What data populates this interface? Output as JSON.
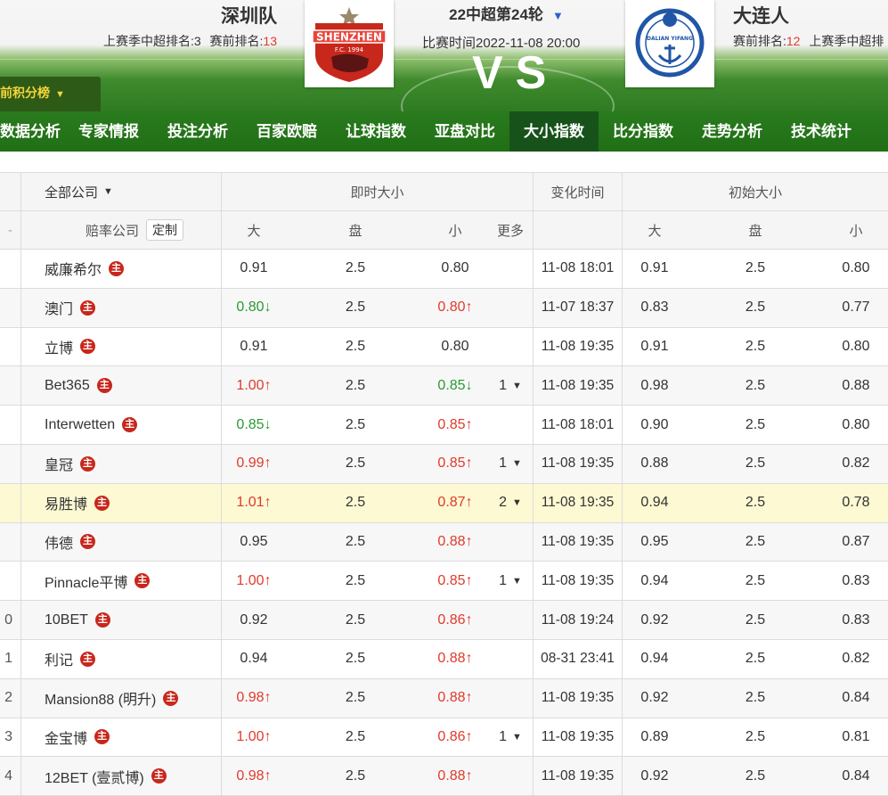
{
  "match": {
    "home": {
      "name": "深圳队",
      "rank_text": "上赛季中超排名:3",
      "pre_rank_label": "赛前排名:",
      "pre_rank_value": "13"
    },
    "away": {
      "name": "大连人",
      "pre_rank_label": "赛前排名:",
      "pre_rank_value": "12",
      "rank_text": "上赛季中超排"
    },
    "round": "22中超第24轮",
    "time": "比赛时间2022-11-08 20:00",
    "vs": "VS",
    "standings": "前积分榜"
  },
  "nav": [
    "数据分析",
    "专家情报",
    "投注分析",
    "百家欧赔",
    "让球指数",
    "亚盘对比",
    "大小指数",
    "比分指数",
    "走势分析",
    "技术统计"
  ],
  "nav_active": "大小指数",
  "table": {
    "all_companies": "全部公司",
    "live_group": "即时大小",
    "change_time": "变化时间",
    "initial_group": "初始大小",
    "company_col": "赔率公司",
    "customize": "定制",
    "col_big": "大",
    "col_line": "盘",
    "col_small": "小",
    "col_more": "更多",
    "main_badge": "主",
    "rows": [
      {
        "no": "",
        "company": "威廉希尔",
        "big": "0.91",
        "big_dir": "",
        "line": "2.5",
        "small": "0.80",
        "small_dir": "",
        "more": "",
        "time": "11-08 18:01",
        "i_big": "0.91",
        "i_line": "2.5",
        "i_small": "0.80"
      },
      {
        "no": "",
        "company": "澳门",
        "big": "0.80",
        "big_dir": "down",
        "line": "2.5",
        "small": "0.80",
        "small_dir": "up",
        "more": "",
        "time": "11-07 18:37",
        "i_big": "0.83",
        "i_line": "2.5",
        "i_small": "0.77"
      },
      {
        "no": "",
        "company": "立博",
        "big": "0.91",
        "big_dir": "",
        "line": "2.5",
        "small": "0.80",
        "small_dir": "",
        "more": "",
        "time": "11-08 19:35",
        "i_big": "0.91",
        "i_line": "2.5",
        "i_small": "0.80"
      },
      {
        "no": "",
        "company": "Bet365",
        "big": "1.00",
        "big_dir": "up",
        "line": "2.5",
        "small": "0.85",
        "small_dir": "down",
        "more": "1",
        "time": "11-08 19:35",
        "i_big": "0.98",
        "i_line": "2.5",
        "i_small": "0.88"
      },
      {
        "no": "",
        "company": "Interwetten",
        "big": "0.85",
        "big_dir": "down",
        "line": "2.5",
        "small": "0.85",
        "small_dir": "up",
        "more": "",
        "time": "11-08 18:01",
        "i_big": "0.90",
        "i_line": "2.5",
        "i_small": "0.80"
      },
      {
        "no": "",
        "company": "皇冠",
        "big": "0.99",
        "big_dir": "up",
        "line": "2.5",
        "small": "0.85",
        "small_dir": "up",
        "more": "1",
        "time": "11-08 19:35",
        "i_big": "0.88",
        "i_line": "2.5",
        "i_small": "0.82"
      },
      {
        "no": "",
        "company": "易胜博",
        "big": "1.01",
        "big_dir": "up",
        "line": "2.5",
        "small": "0.87",
        "small_dir": "up",
        "more": "2",
        "time": "11-08 19:35",
        "i_big": "0.94",
        "i_line": "2.5",
        "i_small": "0.78"
      },
      {
        "no": "",
        "company": "伟德",
        "big": "0.95",
        "big_dir": "",
        "line": "2.5",
        "small": "0.88",
        "small_dir": "up",
        "more": "",
        "time": "11-08 19:35",
        "i_big": "0.95",
        "i_line": "2.5",
        "i_small": "0.87"
      },
      {
        "no": "",
        "company": "Pinnacle平博",
        "big": "1.00",
        "big_dir": "up",
        "line": "2.5",
        "small": "0.85",
        "small_dir": "up",
        "more": "1",
        "time": "11-08 19:35",
        "i_big": "0.94",
        "i_line": "2.5",
        "i_small": "0.83"
      },
      {
        "no": "0",
        "company": "10BET",
        "big": "0.92",
        "big_dir": "",
        "line": "2.5",
        "small": "0.86",
        "small_dir": "up",
        "more": "",
        "time": "11-08 19:24",
        "i_big": "0.92",
        "i_line": "2.5",
        "i_small": "0.83"
      },
      {
        "no": "1",
        "company": "利记",
        "big": "0.94",
        "big_dir": "",
        "line": "2.5",
        "small": "0.88",
        "small_dir": "up",
        "more": "",
        "time": "08-31 23:41",
        "i_big": "0.94",
        "i_line": "2.5",
        "i_small": "0.82"
      },
      {
        "no": "2",
        "company": "Mansion88 (明升)",
        "big": "0.98",
        "big_dir": "up",
        "line": "2.5",
        "small": "0.88",
        "small_dir": "up",
        "more": "",
        "time": "11-08 19:35",
        "i_big": "0.92",
        "i_line": "2.5",
        "i_small": "0.84"
      },
      {
        "no": "3",
        "company": "金宝博",
        "big": "1.00",
        "big_dir": "up",
        "line": "2.5",
        "small": "0.86",
        "small_dir": "up",
        "more": "1",
        "time": "11-08 19:35",
        "i_big": "0.89",
        "i_line": "2.5",
        "i_small": "0.81"
      },
      {
        "no": "4",
        "company": "12BET (壹贰博)",
        "big": "0.98",
        "big_dir": "up",
        "line": "2.5",
        "small": "0.88",
        "small_dir": "up",
        "more": "",
        "time": "11-08 19:35",
        "i_big": "0.92",
        "i_line": "2.5",
        "i_small": "0.84"
      }
    ]
  },
  "colors": {
    "up": "#e03a2c",
    "down": "#2b9a32",
    "nav_bg": "#206f16",
    "nav_active": "#17521a",
    "highlight_row": "#fcf9d3",
    "badge": "#c8271c"
  }
}
